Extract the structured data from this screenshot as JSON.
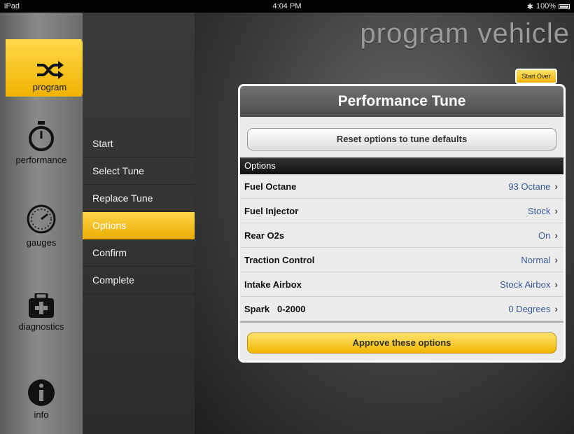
{
  "status_bar": {
    "device": "iPad",
    "time": "4:04 PM",
    "battery": "100%"
  },
  "rail": {
    "items": [
      {
        "label": "program",
        "icon": "shuffle-icon",
        "active": true
      },
      {
        "label": "performance",
        "icon": "stopwatch-icon"
      },
      {
        "label": "gauges",
        "icon": "gauge-icon"
      },
      {
        "label": "diagnostics",
        "icon": "toolbox-icon"
      },
      {
        "label": "info",
        "icon": "info-icon"
      }
    ]
  },
  "steps": [
    {
      "label": "Start"
    },
    {
      "label": "Select Tune"
    },
    {
      "label": "Replace Tune"
    },
    {
      "label": "Options",
      "active": true
    },
    {
      "label": "Confirm"
    },
    {
      "label": "Complete"
    }
  ],
  "main": {
    "title": "program vehicle",
    "start_over": "Start Over"
  },
  "panel": {
    "title": "Performance Tune",
    "reset_label": "Reset options to tune defaults",
    "section": "Options",
    "options": [
      {
        "label": "Fuel Octane",
        "value": "93 Octane"
      },
      {
        "label": "Fuel Injector",
        "value": "Stock"
      },
      {
        "label": "Rear O2s",
        "value": "On"
      },
      {
        "label": "Traction Control",
        "value": "Normal"
      },
      {
        "label": "Intake Airbox",
        "value": "Stock Airbox"
      },
      {
        "label": "Spark   0-2000",
        "value": "0 Degrees"
      }
    ],
    "approve_label": "Approve these options"
  },
  "colors": {
    "accent": "#f0b400",
    "value_text": "#3a5a99"
  }
}
